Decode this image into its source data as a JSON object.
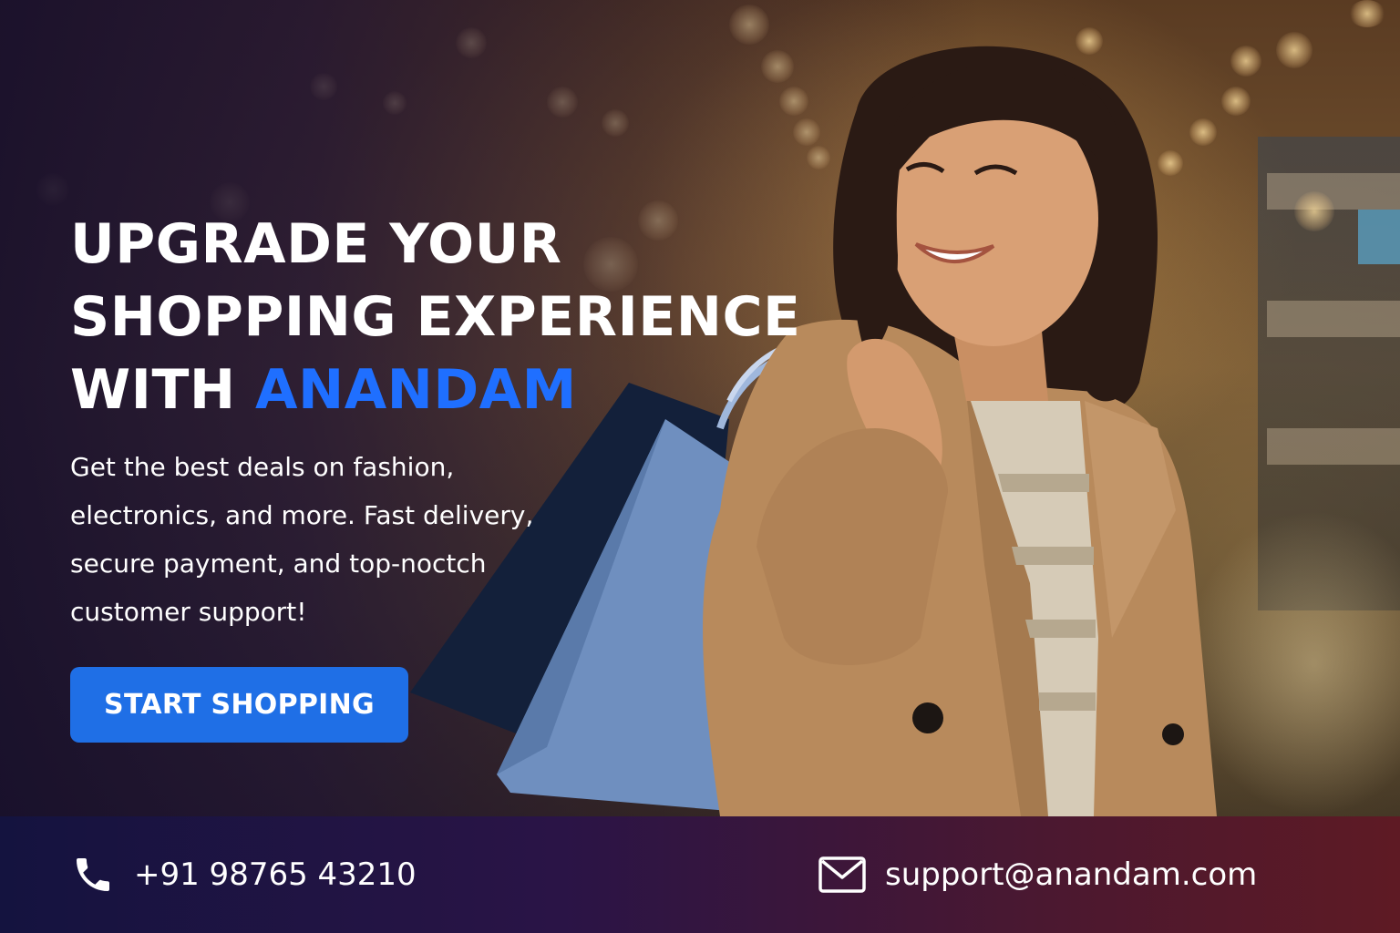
{
  "hero": {
    "headline_line1": "UPGRADE YOUR",
    "headline_line2": "SHOPPING EXPERIENCE",
    "headline_with": "WITH ",
    "headline_brand": "ANANDAM",
    "subcopy": "Get the best deals on fashion, electronics, and more. Fast delivery, secure payment, and top-noctch customer support!",
    "cta_label": "START SHOPPING"
  },
  "footer": {
    "phone_icon": "phone-icon",
    "phone": "+91 98765 43210",
    "email_icon": "mail-icon",
    "email": "support@anandam.com"
  },
  "colors": {
    "accent": "#1f6fff",
    "cta": "#1f6fe6",
    "footer_start": "#14133f",
    "footer_end": "#5e1a24"
  }
}
